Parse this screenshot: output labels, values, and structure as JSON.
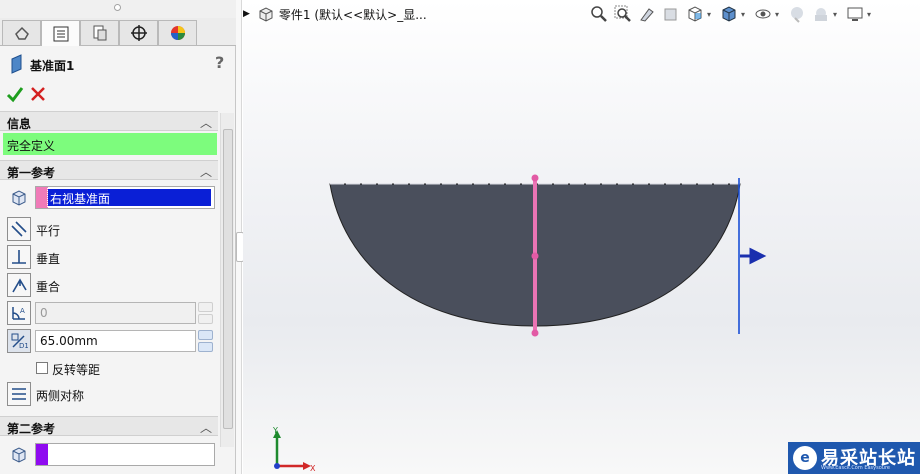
{
  "property_manager": {
    "tabs": [
      {
        "name": "FeatureManager",
        "icon": "feature-manager-icon"
      },
      {
        "name": "PropertyManager",
        "icon": "property-manager-icon"
      },
      {
        "name": "ConfigurationManager",
        "icon": "configuration-manager-icon"
      },
      {
        "name": "DimXpertManager",
        "icon": "dimxpert-icon"
      },
      {
        "name": "DisplayManager",
        "icon": "display-manager-icon"
      }
    ],
    "title": "基准面1",
    "help_label": "?",
    "info_group": {
      "title": "信息",
      "status": "完全定义",
      "status_color": "#7dfc7d"
    },
    "first_reference": {
      "title": "第一参考",
      "selection": "右视基准面",
      "swatch_color": "#f07bb8",
      "options": {
        "parallel": "平行",
        "perpendicular": "垂直",
        "coincident": "重合"
      },
      "angle_value": "0",
      "distance_value": "65.00mm",
      "flip_offset_label": "反转等距",
      "flip_offset_checked": false,
      "mid_plane_label": "两侧对称"
    },
    "second_reference": {
      "title": "第二参考",
      "swatch_color": "#8f0af0",
      "selection": ""
    }
  },
  "graphics": {
    "tree_flyout_label": "零件1  (默认<<默认>_显...",
    "heads_up_icons": [
      "zoom-to-fit-icon",
      "zoom-to-area-icon",
      "previous-view-icon",
      "section-view-icon",
      "view-orientation-icon",
      "display-style-icon",
      "hide-show-items-icon",
      "edit-appearance-icon",
      "apply-scene-icon",
      "view-settings-icon"
    ],
    "triad": {
      "x_label": "X",
      "y_label": "Y"
    },
    "colors": {
      "part_face": "#4a4f5c",
      "reference_plane": "#ea74b4",
      "preview_plane": "#1a4fd6"
    }
  },
  "watermark": {
    "logo_letter": "e",
    "text": "易采站长站",
    "subtitle": "Www.Easck.Com  Easysoure"
  }
}
